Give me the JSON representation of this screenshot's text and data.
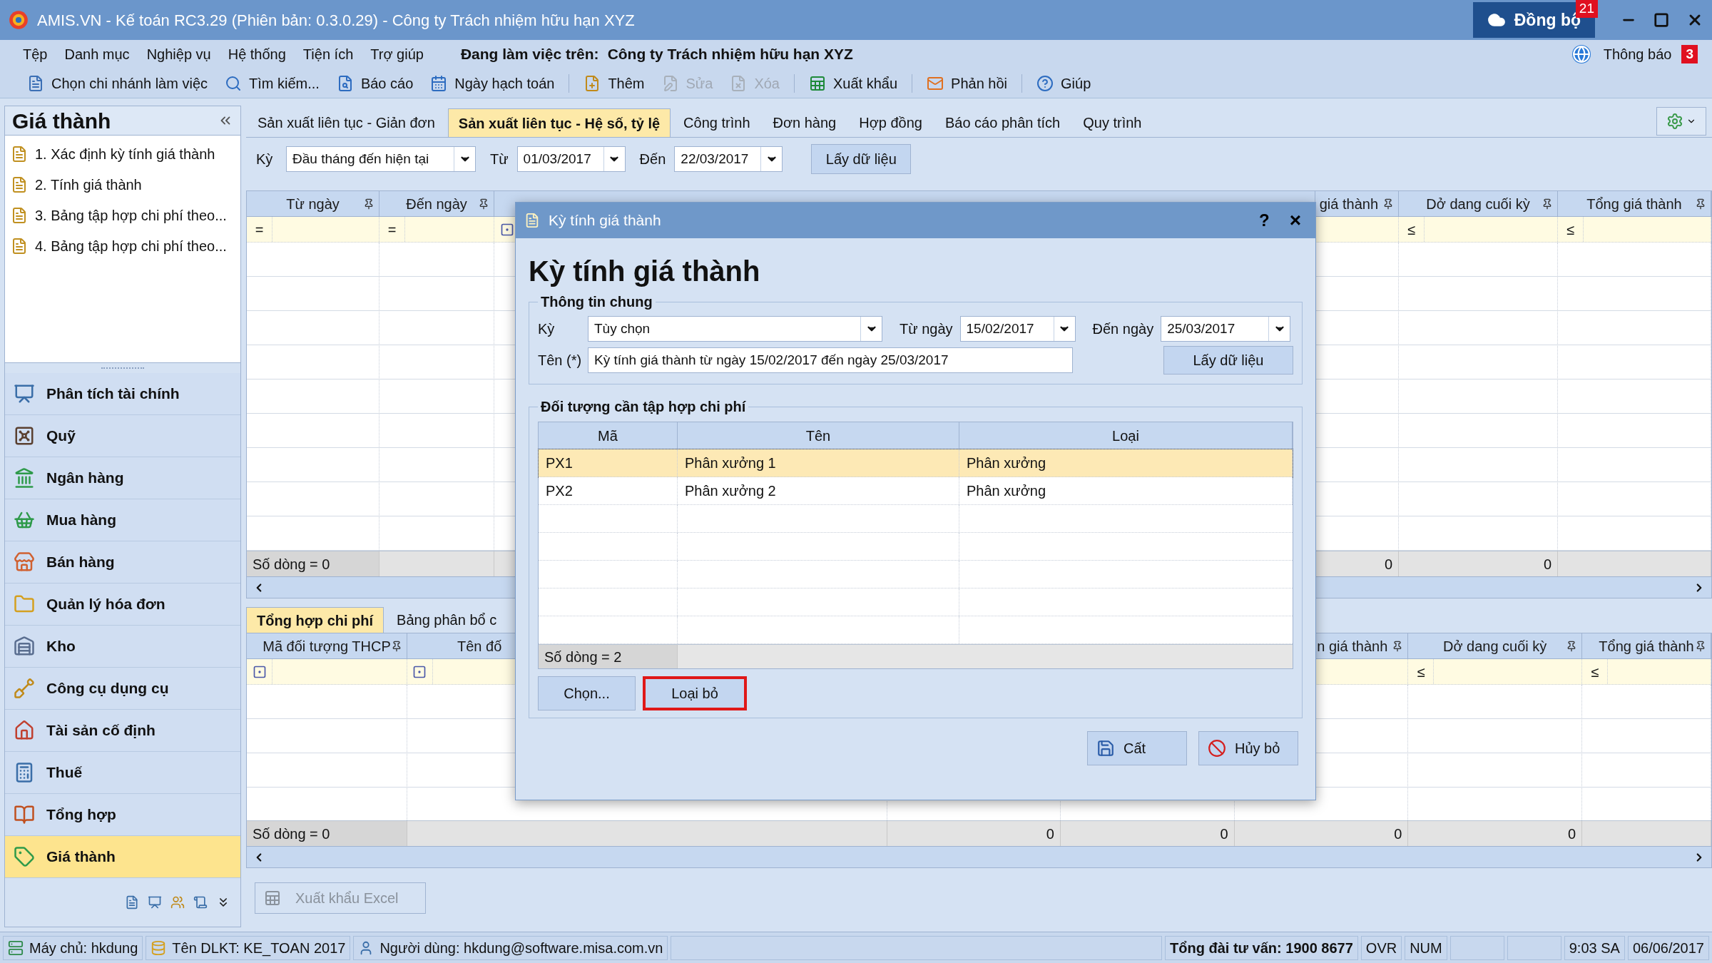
{
  "window": {
    "title": "AMIS.VN - Kế toán RC3.29 (Phiên bản: 0.3.0.29) - Công ty Trách nhiệm hữu hạn XYZ",
    "sync_button": {
      "label": "Đồng bộ",
      "badge": "21"
    }
  },
  "menu": {
    "items": [
      "Tệp",
      "Danh mục",
      "Nghiệp vụ",
      "Hệ thống",
      "Tiện ích",
      "Trợ giúp"
    ],
    "workspace_label": "Đang làm việc trên:",
    "workspace_company": "Công ty Trách nhiệm hữu hạn XYZ",
    "notifications": {
      "label": "Thông báo",
      "badge": "3"
    }
  },
  "toolbar": [
    {
      "label": "Chọn chi nhánh làm việc",
      "kind": "document",
      "disabled": false
    },
    {
      "label": "Tìm kiếm...",
      "kind": "search",
      "disabled": false
    },
    {
      "label": "Báo cáo",
      "kind": "report",
      "disabled": false
    },
    {
      "label": "Ngày hạch toán",
      "kind": "calendar",
      "disabled": false
    },
    {
      "label": "Thêm",
      "kind": "add",
      "disabled": false
    },
    {
      "label": "Sửa",
      "kind": "edit",
      "disabled": true
    },
    {
      "label": "Xóa",
      "kind": "delete",
      "disabled": true
    },
    {
      "label": "Xuất khẩu",
      "kind": "excel",
      "disabled": false
    },
    {
      "label": "Phản hồi",
      "kind": "mail",
      "disabled": false
    },
    {
      "label": "Giúp",
      "kind": "help",
      "disabled": false
    }
  ],
  "sidebar": {
    "title": "Giá thành",
    "tasks": [
      "1. Xác định kỳ tính giá thành",
      "2. Tính giá thành",
      "3. Bảng tập hợp chi phí theo...",
      "4. Bảng tập hợp chi phí theo..."
    ],
    "modules": [
      {
        "label": "Phân tích tài chính",
        "kind": "chart",
        "selected": false
      },
      {
        "label": "Quỹ",
        "kind": "vault",
        "selected": false
      },
      {
        "label": "Ngân hàng",
        "kind": "bank",
        "selected": false
      },
      {
        "label": "Mua hàng",
        "kind": "basket",
        "selected": false
      },
      {
        "label": "Bán hàng",
        "kind": "store",
        "selected": false
      },
      {
        "label": "Quản lý hóa đơn",
        "kind": "folder",
        "selected": false
      },
      {
        "label": "Kho",
        "kind": "warehouse",
        "selected": false
      },
      {
        "label": "Công cụ dụng cụ",
        "kind": "shovel",
        "selected": false
      },
      {
        "label": "Tài sản cố định",
        "kind": "house",
        "selected": false
      },
      {
        "label": "Thuế",
        "kind": "calculator",
        "selected": false
      },
      {
        "label": "Tổng hợp",
        "kind": "book",
        "selected": false
      },
      {
        "label": "Giá thành",
        "kind": "tag",
        "selected": true
      }
    ]
  },
  "tabs": [
    {
      "label": "Sản xuất liên tục - Giản đơn",
      "selected": false
    },
    {
      "label": "Sản xuất liên tục - Hệ số, tỷ lệ",
      "selected": true
    },
    {
      "label": "Công trình",
      "selected": false
    },
    {
      "label": "Đơn hàng",
      "selected": false
    },
    {
      "label": "Hợp đồng",
      "selected": false
    },
    {
      "label": "Báo cáo phân tích",
      "selected": false
    },
    {
      "label": "Quy trình",
      "selected": false
    }
  ],
  "filter": {
    "period_label": "Kỳ",
    "period": "Đầu tháng đến hiện tại",
    "from_label": "Từ",
    "from": "01/03/2017",
    "to_label": "Đến",
    "to": "22/03/2017",
    "fetch_button": "Lấy dữ liệu"
  },
  "upper_grid": {
    "columns": [
      {
        "label": "Từ ngày",
        "filter": "="
      },
      {
        "label": "Đến ngày",
        "filter": "="
      },
      {
        "filter_checkbox": true
      },
      {
        "label": "giá thành",
        "total": "0"
      },
      {
        "label": "Dở dang cuối kỳ",
        "filter": "≤",
        "total": "0"
      },
      {
        "label": "Tổng giá thành",
        "filter": "≤"
      }
    ],
    "row_count": "Số dòng = 0"
  },
  "lower_tabs": [
    {
      "label": "Tổng hợp chi phí",
      "selected": true
    },
    {
      "label": "Bảng phân bổ c",
      "selected": false
    }
  ],
  "lower_grid": {
    "columns": [
      {
        "label": "Mã đối tượng THCP",
        "filter_checkbox": true
      },
      {
        "label": "Tên đố",
        "filter_checkbox": true
      },
      {
        "total": "0"
      },
      {
        "total": "0"
      },
      {
        "label": "n giá thành",
        "total": "0"
      },
      {
        "label": "Dở dang cuối kỳ",
        "filter": "≤",
        "total": "0"
      },
      {
        "label": "Tổng giá thành",
        "filter": "≤"
      }
    ],
    "row_count": "Số dòng = 0"
  },
  "export_button": {
    "label": "Xuất khẩu Excel",
    "disabled": true
  },
  "dialog": {
    "title": "Kỳ tính giá thành",
    "help": "?",
    "close": "×",
    "heading": "Kỳ tính giá thành",
    "general": {
      "legend": "Thông tin chung",
      "period_label": "Kỳ",
      "period": "Tùy chọn",
      "from_label": "Từ ngày",
      "from": "15/02/2017",
      "to_label": "Đến ngày",
      "to": "25/03/2017",
      "name_label": "Tên (*)",
      "name": "Kỳ tính giá thành từ ngày 15/02/2017 đến ngày 25/03/2017",
      "fetch_button": "Lấy dữ liệu"
    },
    "objects": {
      "legend": "Đối tượng cần tập hợp chi phí",
      "columns": [
        "Mã",
        "Tên",
        "Loại"
      ],
      "rows": [
        {
          "cells": [
            "PX1",
            "Phân xưởng 1",
            "Phân xưởng"
          ],
          "selected": true
        },
        {
          "cells": [
            "PX2",
            "Phân xưởng 2",
            "Phân xưởng"
          ],
          "selected": false
        }
      ],
      "row_count": "Số dòng = 2",
      "buttons": [
        {
          "label": "Chọn...",
          "highlighted": false
        },
        {
          "label": "Loại bỏ",
          "highlighted": true
        }
      ]
    },
    "actions": [
      {
        "label": "Cất",
        "kind": "save"
      },
      {
        "label": "Hủy bỏ",
        "kind": "cancel"
      }
    ]
  },
  "status_bar": [
    {
      "text": "Máy chủ: hkdung",
      "kind": "server"
    },
    {
      "text": "Tên DLKT: KE_TOAN 2017",
      "kind": "database"
    },
    {
      "text": "Người dùng: hkdung@software.misa.com.vn",
      "kind": "user"
    },
    {
      "kind": "spacer"
    },
    {
      "text": "Tổng đài tư vấn: 1900 8677",
      "kind": "bold"
    },
    {
      "text": "OVR",
      "kind": "text"
    },
    {
      "text": "NUM",
      "kind": "text"
    },
    {
      "kind": "blank"
    },
    {
      "kind": "blank"
    },
    {
      "text": "9:03 SA",
      "kind": "text"
    },
    {
      "text": "06/06/2017",
      "kind": "text"
    }
  ]
}
